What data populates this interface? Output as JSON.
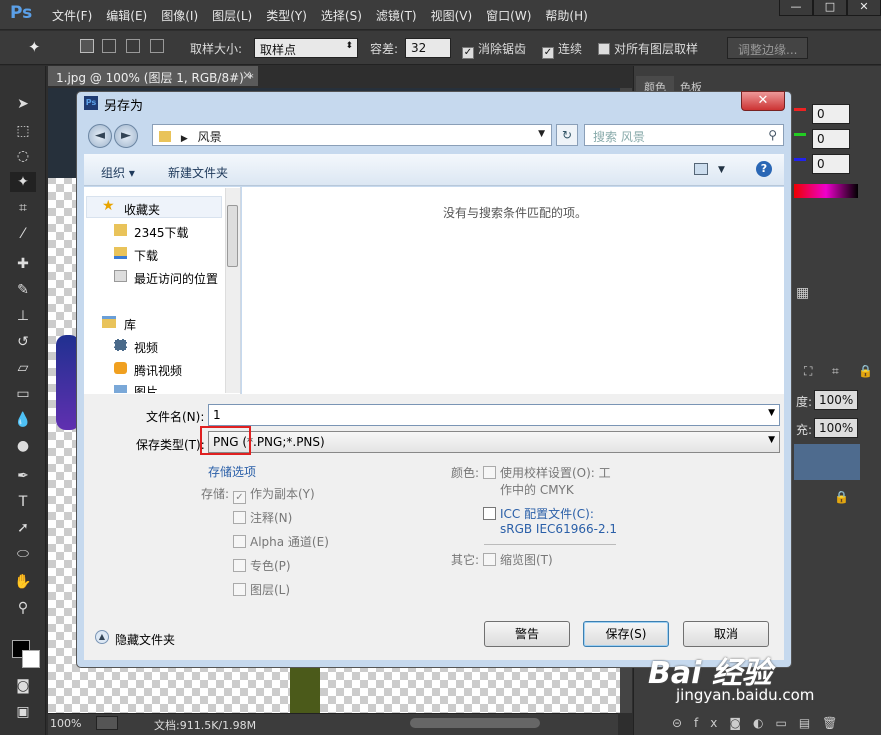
{
  "app": {
    "logo": "Ps"
  },
  "menu": [
    "文件(F)",
    "编辑(E)",
    "图像(I)",
    "图层(L)",
    "类型(Y)",
    "选择(S)",
    "滤镜(T)",
    "视图(V)",
    "窗口(W)",
    "帮助(H)"
  ],
  "window_controls": {
    "min": "—",
    "max": "□",
    "close": "✕"
  },
  "options": {
    "sample_size_label": "取样大小:",
    "sample_size_value": "取样点",
    "tolerance_label": "容差:",
    "tolerance_value": "32",
    "antialias": "消除锯齿",
    "contiguous": "连续",
    "sample_all": "对所有图层取样",
    "refine": "调整边缘..."
  },
  "document": {
    "tab": "1.jpg @ 100% (图层 1, RGB/8#) *",
    "tab_close": "×"
  },
  "status": {
    "zoom": "100%",
    "doc": "文档:911.5K/1.98M"
  },
  "panels": {
    "tabs": [
      "颜色",
      "色板"
    ],
    "color_values": [
      "0",
      "0",
      "0"
    ],
    "opacity_label": "度:",
    "opacity_value": "100%",
    "fill_label": "充:",
    "fill_value": "100%"
  },
  "dialog": {
    "title": "另存为",
    "close": "✕",
    "path": "风景",
    "search_placeholder": "搜索 风景",
    "organize": "组织 ▾",
    "new_folder": "新建文件夹",
    "empty_message": "没有与搜索条件匹配的项。",
    "nav": {
      "favorites": "收藏夹",
      "favorite_items": [
        "2345下载",
        "下载",
        "最近访问的位置"
      ],
      "libraries": "库",
      "library_items": [
        "视频",
        "腾讯视频",
        "图片"
      ]
    },
    "filename_label": "文件名(N):",
    "filename_value": "1",
    "type_label": "保存类型(T):",
    "type_value": "PNG (*.PNG;*.PNS)",
    "save_options_heading": "存储选项",
    "save_label": "存储:",
    "save_checks": [
      {
        "label": "作为副本(Y)",
        "checked": true
      },
      {
        "label": "注释(N)",
        "checked": false
      },
      {
        "label": "Alpha 通道(E)",
        "checked": false
      },
      {
        "label": "专色(P)",
        "checked": false
      },
      {
        "label": "图层(L)",
        "checked": false
      }
    ],
    "color_label": "颜色:",
    "proof_label": "使用校样设置(O): 工",
    "proof_label2": "作中的 CMYK",
    "icc_label": "ICC 配置文件(C):",
    "icc_value": "sRGB IEC61966-2.1",
    "other_label": "其它:",
    "thumbnail_label": "缩览图(T)",
    "hide_folders": "隐藏文件夹",
    "buttons": {
      "warning": "警告",
      "save": "保存(S)",
      "cancel": "取消"
    },
    "highlight_color": "#e02020"
  },
  "watermark": {
    "brand": "Bai 经验",
    "url": "jingyan.baidu.com"
  }
}
